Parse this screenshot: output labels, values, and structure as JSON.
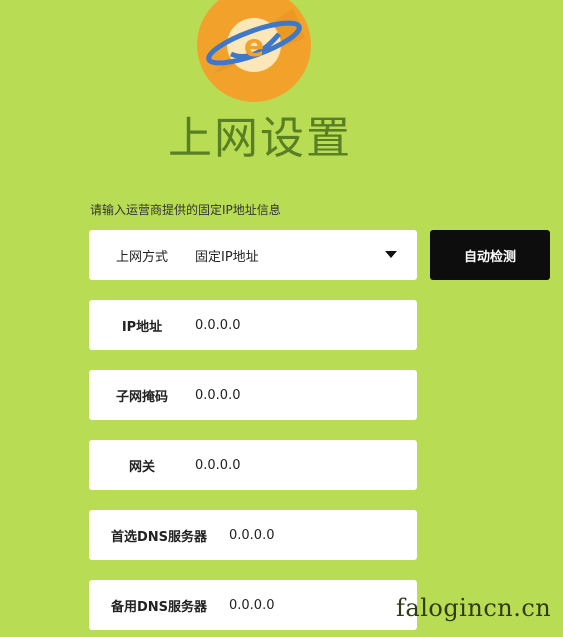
{
  "page": {
    "title": "上网设置",
    "instruction": "请输入运营商提供的固定IP地址信息"
  },
  "form": {
    "connection_type": {
      "label": "上网方式",
      "value": "固定IP地址"
    },
    "ip_address": {
      "label": "IP地址",
      "value": "0.0.0.0"
    },
    "subnet_mask": {
      "label": "子网掩码",
      "value": "0.0.0.0"
    },
    "gateway": {
      "label": "网关",
      "value": "0.0.0.0"
    },
    "primary_dns": {
      "label": "首选DNS服务器",
      "value": "0.0.0.0"
    },
    "secondary_dns": {
      "label": "备用DNS服务器",
      "value": "0.0.0.0"
    }
  },
  "actions": {
    "auto_detect_label": "自动检测"
  },
  "watermark": "falogincn.cn",
  "icons": {
    "logo": "globe-e-logo-icon",
    "dropdown": "caret-down-icon"
  },
  "colors": {
    "background": "#b9dc55",
    "title": "#5a7f22",
    "button": "#0d0d0d",
    "logo_orange": "#f2a22a"
  }
}
